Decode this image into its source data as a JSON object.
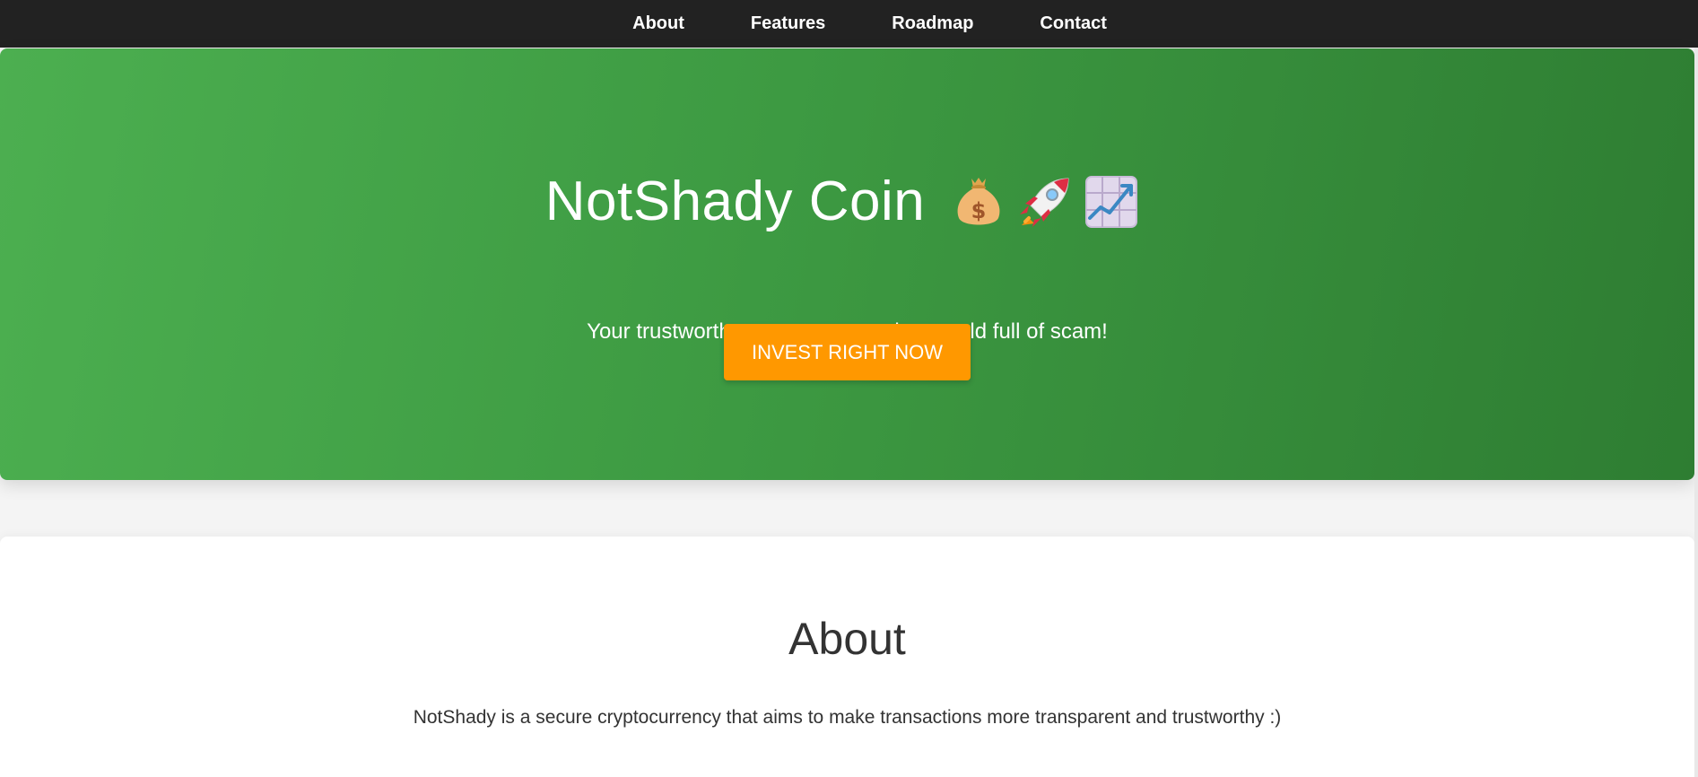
{
  "nav": {
    "items": [
      {
        "label": "About"
      },
      {
        "label": "Features"
      },
      {
        "label": "Roadmap"
      },
      {
        "label": "Contact"
      }
    ]
  },
  "hero": {
    "title": "NotShady Coin",
    "emojis": [
      "money-bag-icon",
      "rocket-icon",
      "chart-increasing-icon"
    ],
    "subtitle": "Your trustworthy cryptocurrency in a world full of scam!",
    "cta_label": "INVEST RIGHT NOW",
    "gradient_start": "#4caf50",
    "gradient_end": "#2e7d32",
    "cta_color": "#ff9800"
  },
  "about": {
    "heading": "About",
    "text": "NotShady is a secure cryptocurrency that aims to make transactions more transparent and trustworthy :)"
  },
  "colors": {
    "nav_bg": "#222222",
    "page_bg": "#f4f4f4",
    "text_dark": "#333333"
  }
}
